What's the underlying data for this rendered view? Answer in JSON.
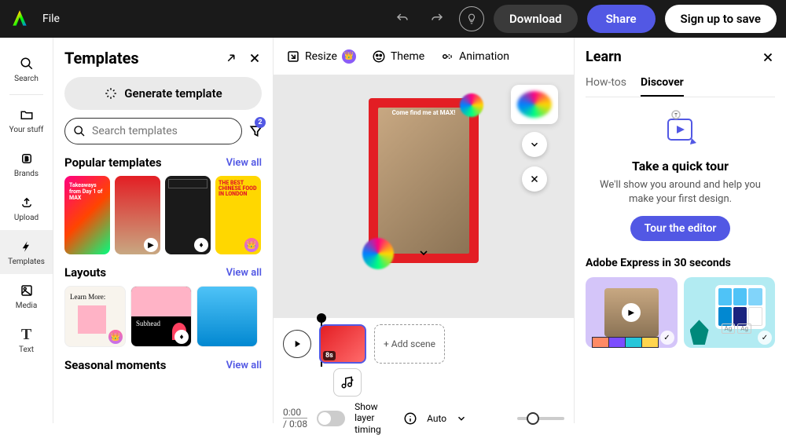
{
  "topbar": {
    "file_menu": "File",
    "download": "Download",
    "share": "Share",
    "signup": "Sign up to save"
  },
  "rail": {
    "search": "Search",
    "your_stuff": "Your stuff",
    "brands": "Brands",
    "upload": "Upload",
    "templates": "Templates",
    "media": "Media",
    "text": "Text"
  },
  "panel": {
    "title": "Templates",
    "generate": "Generate template",
    "search_placeholder": "Search templates",
    "filter_count": "2",
    "popular_title": "Popular templates",
    "view_all": "View all",
    "layouts_title": "Layouts",
    "seasonal_title": "Seasonal moments",
    "thumb1_text": "Takeaways from Day 1 of MAX",
    "thumb4_text": "THE BEST CHINESE FOOD IN LONDON",
    "layout1_text": "Learn More:",
    "layout2_text": "Subhead"
  },
  "canvas_toolbar": {
    "resize": "Resize",
    "theme": "Theme",
    "animation": "Animation"
  },
  "canvas": {
    "text": "Come find me at MAX!"
  },
  "timeline": {
    "scene_duration": "8s",
    "add_scene": "+ Add scene",
    "time_current": "0:00",
    "time_total": "0:08",
    "show_layer": "Show layer timing",
    "auto": "Auto"
  },
  "learn": {
    "title": "Learn",
    "tab_howtos": "How-tos",
    "tab_discover": "Discover",
    "tour_title": "Take a quick tour",
    "tour_desc": "We'll show you around and help you make your first design.",
    "tour_btn": "Tour the editor",
    "video_section": "Adobe Express in 30 seconds"
  }
}
